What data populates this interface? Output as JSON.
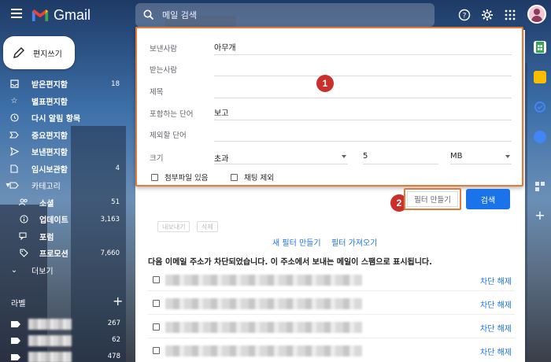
{
  "app": {
    "name": "Gmail"
  },
  "search": {
    "placeholder": "메일 검색"
  },
  "compose": {
    "label": "편지쓰기"
  },
  "sidebar": {
    "items": [
      {
        "label": "받은편지함",
        "count": "18",
        "icon": "inbox-icon"
      },
      {
        "label": "별표편지함",
        "count": "",
        "icon": "star-icon"
      },
      {
        "label": "다시 알림 항목",
        "count": "",
        "icon": "clock-icon"
      },
      {
        "label": "중요편지함",
        "count": "",
        "icon": "important-icon"
      },
      {
        "label": "보낸편지함",
        "count": "",
        "icon": "send-icon"
      },
      {
        "label": "임시보관함",
        "count": "4",
        "icon": "draft-icon"
      },
      {
        "label": "카테고리",
        "count": "",
        "icon": "label-icon"
      }
    ],
    "categories": [
      {
        "label": "소셜",
        "count": "51",
        "icon": "people-icon"
      },
      {
        "label": "업데이트",
        "count": "3,163",
        "icon": "info-icon"
      },
      {
        "label": "포럼",
        "count": "",
        "icon": "forum-icon"
      },
      {
        "label": "프로모션",
        "count": "7,660",
        "icon": "tag-icon"
      }
    ],
    "more": "더보기",
    "labels_heading": "라벨",
    "labels": [
      {
        "count": "267"
      },
      {
        "count": "62"
      },
      {
        "count": "478"
      }
    ]
  },
  "search_panel": {
    "from_label": "보낸사람",
    "from_value": "아무개",
    "to_label": "받는사람",
    "to_value": "",
    "subject_label": "제목",
    "subject_value": "",
    "has_words_label": "포함하는 단어",
    "has_words_value": "보고",
    "not_words_label": "제외할 단어",
    "not_words_value": "",
    "size_label": "크기",
    "size_op": "초과",
    "size_value": "5",
    "size_unit": "MB",
    "attachment_label": "첨부파일 있음",
    "exclude_chats_label": "채팅 제외",
    "create_filter": "필터 만들기",
    "search": "검색",
    "marker1": "1",
    "marker2": "2"
  },
  "main": {
    "ghost_btn1": "내보내기",
    "ghost_btn2": "삭제",
    "new_filter": "새 필터 만들기",
    "import_filter": "필터 가져오기",
    "blocked_notice": "다음 이메일 주소가 차단되었습니다. 이 주소에서 보내는 메일이 스팸으로 표시됩니다.",
    "unblock": "차단 해제",
    "blocked_rows": [
      {
        "unblock": "차단 해제"
      },
      {
        "unblock": "차단 해제"
      },
      {
        "unblock": "차단 해제"
      },
      {
        "unblock": "차단 해제"
      }
    ]
  },
  "colors": {
    "accent": "#1a73e8",
    "highlight": "#e07b39",
    "marker": "#c9302c"
  }
}
